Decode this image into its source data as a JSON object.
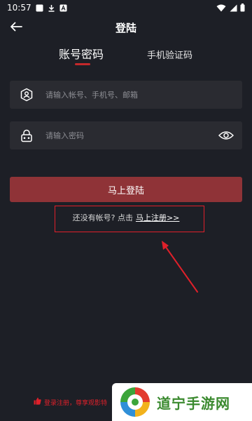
{
  "status_bar": {
    "time": "10:57",
    "icons": [
      "app-notification-icon",
      "download-icon",
      "text-badge-icon",
      "wifi-icon",
      "signal-icon",
      "battery-icon"
    ]
  },
  "header": {
    "title": "登陆",
    "back_icon": "back-arrow-icon"
  },
  "tabs": [
    {
      "label": "账号密码",
      "active": true
    },
    {
      "label": "手机验证码",
      "active": false
    }
  ],
  "form": {
    "username": {
      "placeholder": "请输入帐号、手机号、邮箱",
      "value": "",
      "icon": "user-shield-icon"
    },
    "password": {
      "placeholder": "请输入密码",
      "value": "",
      "icon": "lock-icon",
      "toggle_icon": "eye-icon"
    }
  },
  "login_button": {
    "label": "马上登陆"
  },
  "register": {
    "prompt": "还没有帐号? 点击",
    "link": "马上注册>>"
  },
  "bottom_notice": {
    "text": "登录注册，尊享观影特",
    "icon": "thumbs-up-icon"
  },
  "watermark": {
    "text": "道宁手游网"
  },
  "colors": {
    "background": "#1d1f26",
    "input_bg": "#2a2b31",
    "accent": "#c4282b",
    "login_button": "#8f3337",
    "annotation": "#e0202a"
  }
}
